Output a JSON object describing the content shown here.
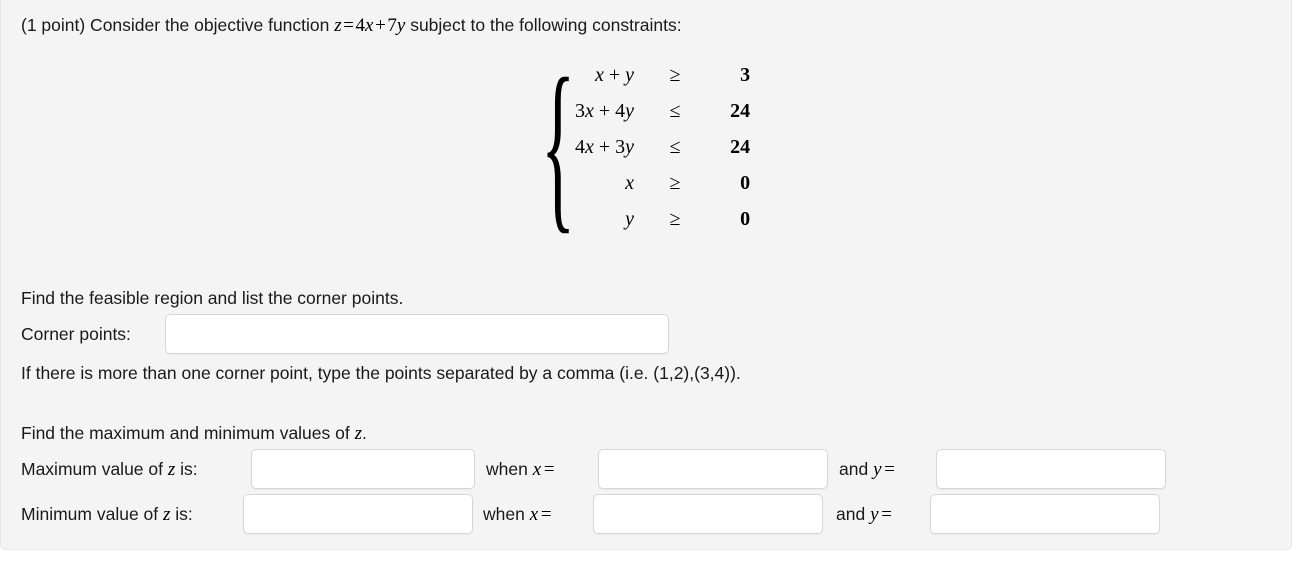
{
  "problem": {
    "intro_prefix": "(1 point) Consider the objective function ",
    "objective": {
      "z": "z",
      "eq": "=",
      "term1_coef": "4",
      "term1_var": "x",
      "plus": "+",
      "term2_coef": "7",
      "term2_var": "y"
    },
    "intro_suffix": " subject to the following constraints:",
    "brace": "{"
  },
  "constraints": [
    {
      "lhs_html": "x + y",
      "lhs_plain": "x + y",
      "rel": "≥",
      "rhs": "3"
    },
    {
      "lhs_html": "3x + 4y",
      "lhs_plain": "3x + 4y",
      "rel": "≤",
      "rhs": "24"
    },
    {
      "lhs_html": "4x + 3y",
      "lhs_plain": "4x + 3y",
      "rel": "≤",
      "rhs": "24"
    },
    {
      "lhs_html": "x",
      "lhs_plain": "x",
      "rel": "≥",
      "rhs": "0"
    },
    {
      "lhs_html": "y",
      "lhs_plain": "y",
      "rel": "≥",
      "rhs": "0"
    }
  ],
  "part1": {
    "prompt": "Find the feasible region and list the corner points.",
    "corner_label": "Corner points:",
    "corner_value": "",
    "hint": "If there is more than one corner point, type the points separated by a comma (i.e. (1,2),(3,4))."
  },
  "part2": {
    "prompt_prefix": "Find the maximum and minimum values of ",
    "prompt_var": "z",
    "prompt_suffix": ".",
    "max_label_prefix": "Maximum value of ",
    "max_label_var": "z",
    "max_label_suffix": " is:",
    "min_label_prefix": "Minimum value of ",
    "min_label_var": "z",
    "min_label_suffix": " is:",
    "when_x": "when x =",
    "and_y": "and y =",
    "when_word": "when ",
    "and_word": "and ",
    "x_var": "x",
    "y_var": "y",
    "equals": "=",
    "max_z_value": "",
    "max_x_value": "",
    "max_y_value": "",
    "min_z_value": "",
    "min_x_value": "",
    "min_y_value": ""
  },
  "theme": {
    "panel_bg": "#f4f4f4",
    "text_color": "#1a1a1a",
    "input_bg": "#ffffff",
    "input_border": "#d6d6d6"
  }
}
